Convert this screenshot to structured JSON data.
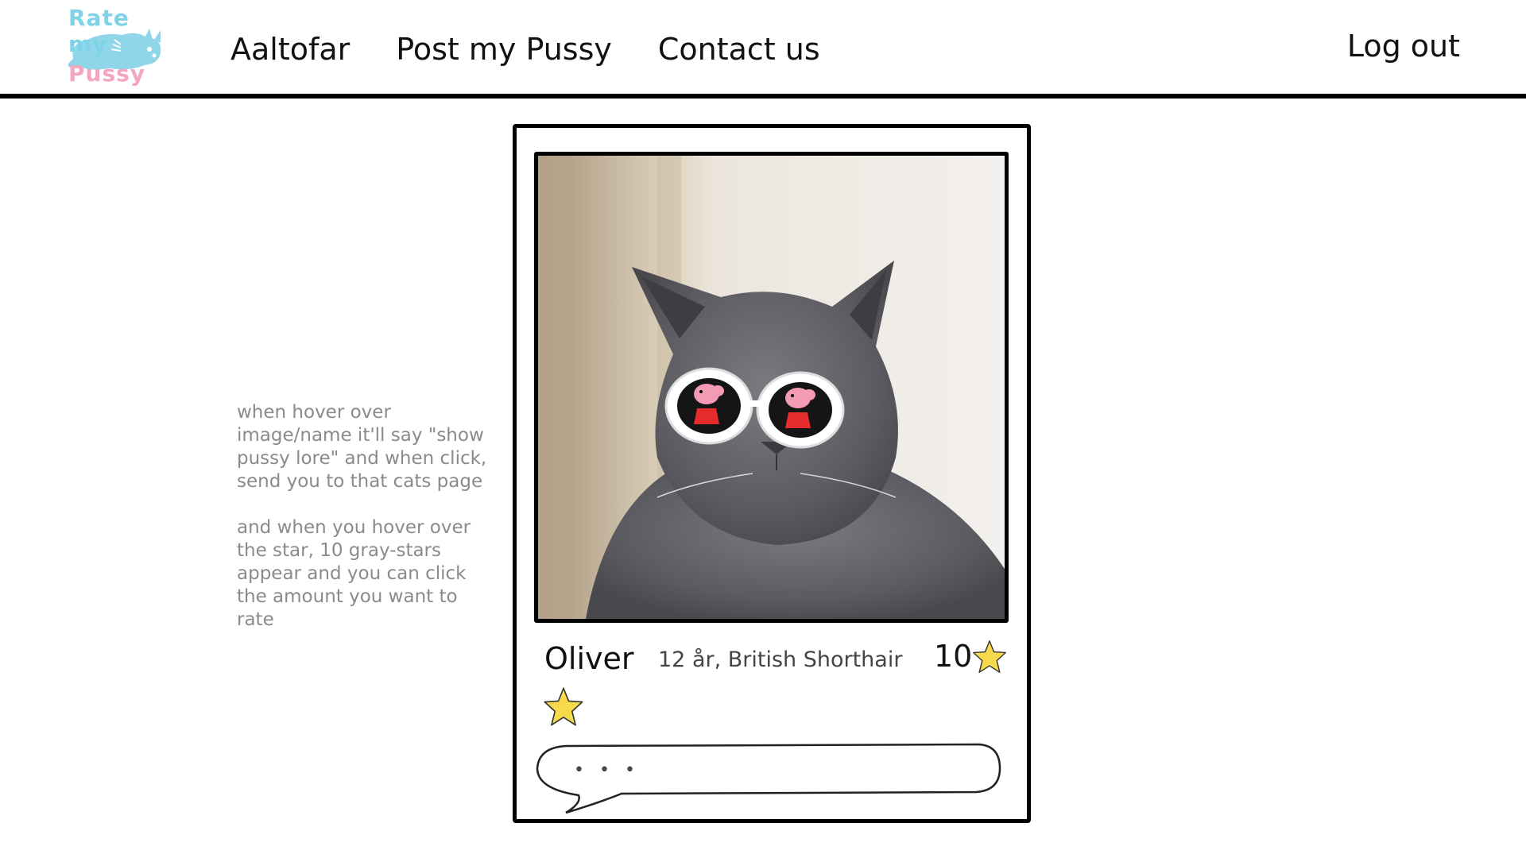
{
  "brand": {
    "logo_top": "Rate my",
    "logo_bottom": "Pussy",
    "logo_colors": {
      "blue": "#7fd3e8",
      "pink": "#f4a6bf"
    }
  },
  "nav": {
    "items": [
      {
        "label": "Aaltofar"
      },
      {
        "label": "Post my Pussy"
      },
      {
        "label": "Contact us"
      }
    ],
    "logout": "Log out"
  },
  "note": {
    "paragraph1": "when hover over image/name it'll say \"show pussy lore\" and when click, send you to that cats page",
    "paragraph2": "and when you hover over the star, 10 gray-stars appear and you can click the amount you want to rate"
  },
  "card": {
    "photo_icon": "cat-with-peppa-pig-sunglasses",
    "name": "Oliver",
    "meta": "12 år, British Shorthair",
    "score": "10",
    "star_color": "#f7d94c",
    "comment_placeholder": "• • •"
  }
}
